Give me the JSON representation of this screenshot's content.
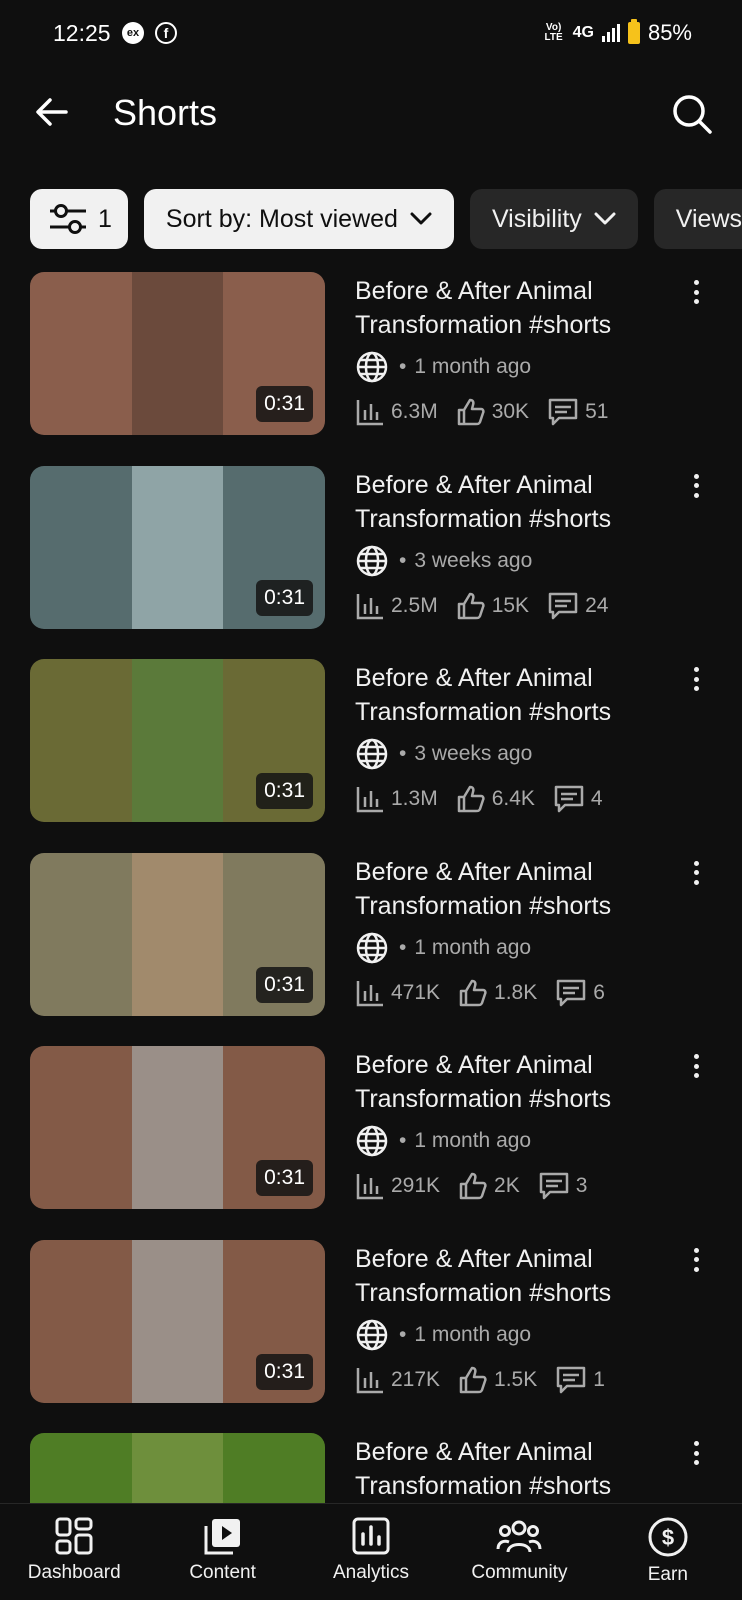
{
  "status_bar": {
    "time": "12:25",
    "ex_label": "ex",
    "fb_label": "f",
    "volte": "Vo) LTE",
    "network": "4G",
    "battery": "85%"
  },
  "header": {
    "title": "Shorts",
    "back_icon": "arrow-left-icon",
    "search_icon": "search-icon"
  },
  "filters": {
    "filter_count": "1",
    "sort_label": "Sort by: Most viewed",
    "visibility_label": "Visibility",
    "views_label": "Views"
  },
  "videos": [
    {
      "title": "Before & After Animal Transformation #shorts",
      "visibility_icon": "globe-icon",
      "age": "1 month ago",
      "duration": "0:31",
      "views": "6.3M",
      "likes": "30K",
      "comments": "51",
      "bg": "#8a5e4c",
      "center": "#6b4a3c"
    },
    {
      "title": "Before & After Animal Transformation #shorts",
      "visibility_icon": "globe-icon",
      "age": "3 weeks ago",
      "duration": "0:31",
      "views": "2.5M",
      "likes": "15K",
      "comments": "24",
      "bg": "#566c6e",
      "center": "#8fa4a6"
    },
    {
      "title": "Before & After Animal Transformation #shorts",
      "visibility_icon": "globe-icon",
      "age": "3 weeks ago",
      "duration": "0:31",
      "views": "1.3M",
      "likes": "6.4K",
      "comments": "4",
      "bg": "#6a6a35",
      "center": "#5b7a3a"
    },
    {
      "title": "Before & After Animal Transformation #shorts",
      "visibility_icon": "globe-icon",
      "age": "1 month ago",
      "duration": "0:31",
      "views": "471K",
      "likes": "1.8K",
      "comments": "6",
      "bg": "#807a5e",
      "center": "#a18a6c"
    },
    {
      "title": "Before & After Animal Transformation #shorts",
      "visibility_icon": "globe-icon",
      "age": "1 month ago",
      "duration": "0:31",
      "views": "291K",
      "likes": "2K",
      "comments": "3",
      "bg": "#835a47",
      "center": "#9a8f88"
    },
    {
      "title": "Before & After Animal Transformation #shorts",
      "visibility_icon": "globe-icon",
      "age": "1 month ago",
      "duration": "0:31",
      "views": "217K",
      "likes": "1.5K",
      "comments": "1",
      "bg": "#835a47",
      "center": "#9a8f88"
    },
    {
      "title": "Before & After Animal Transformation #shorts",
      "visibility_icon": "globe-icon",
      "age": "",
      "duration": "",
      "views": "",
      "likes": "",
      "comments": "",
      "bg": "#4f7d25",
      "center": "#6e8f3c"
    }
  ],
  "bottom_nav": [
    {
      "label": "Dashboard",
      "icon": "dashboard-icon"
    },
    {
      "label": "Content",
      "icon": "content-icon"
    },
    {
      "label": "Analytics",
      "icon": "analytics-icon"
    },
    {
      "label": "Community",
      "icon": "community-icon"
    },
    {
      "label": "Earn",
      "icon": "earn-icon"
    }
  ]
}
